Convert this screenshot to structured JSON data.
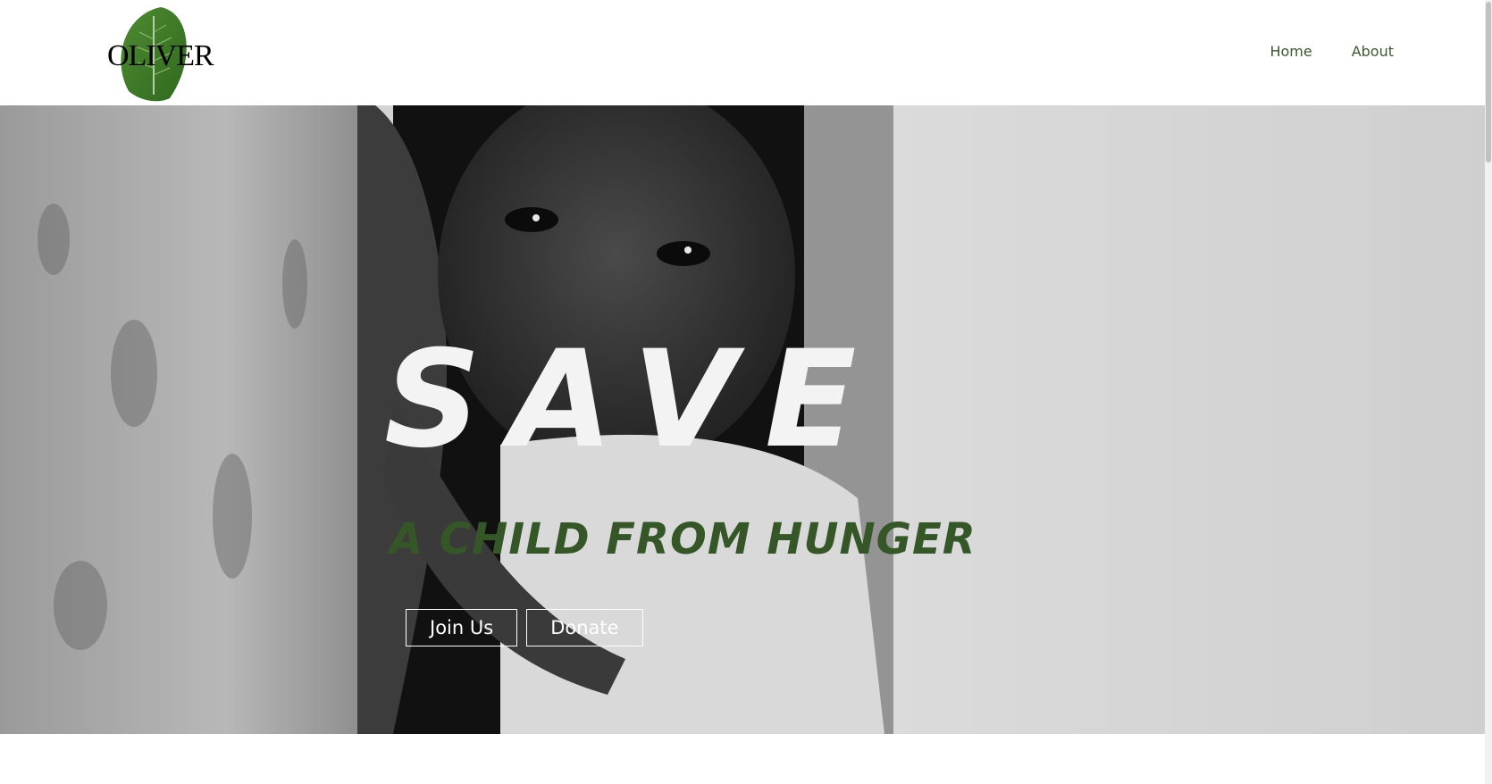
{
  "brand": {
    "logo_text": "OLIVER"
  },
  "nav": {
    "items": [
      {
        "label": "Home"
      },
      {
        "label": "About"
      }
    ]
  },
  "hero": {
    "title": "SAVE",
    "subtitle": "A CHILD FROM HUNGER",
    "buttons": {
      "join": "Join Us",
      "donate": "Donate"
    },
    "image_icon": "child-photo"
  },
  "colors": {
    "accent": "#355728",
    "nav_text": "#3a5a2a",
    "title_text": "#f3f3f3",
    "button_border": "#ffffff"
  }
}
